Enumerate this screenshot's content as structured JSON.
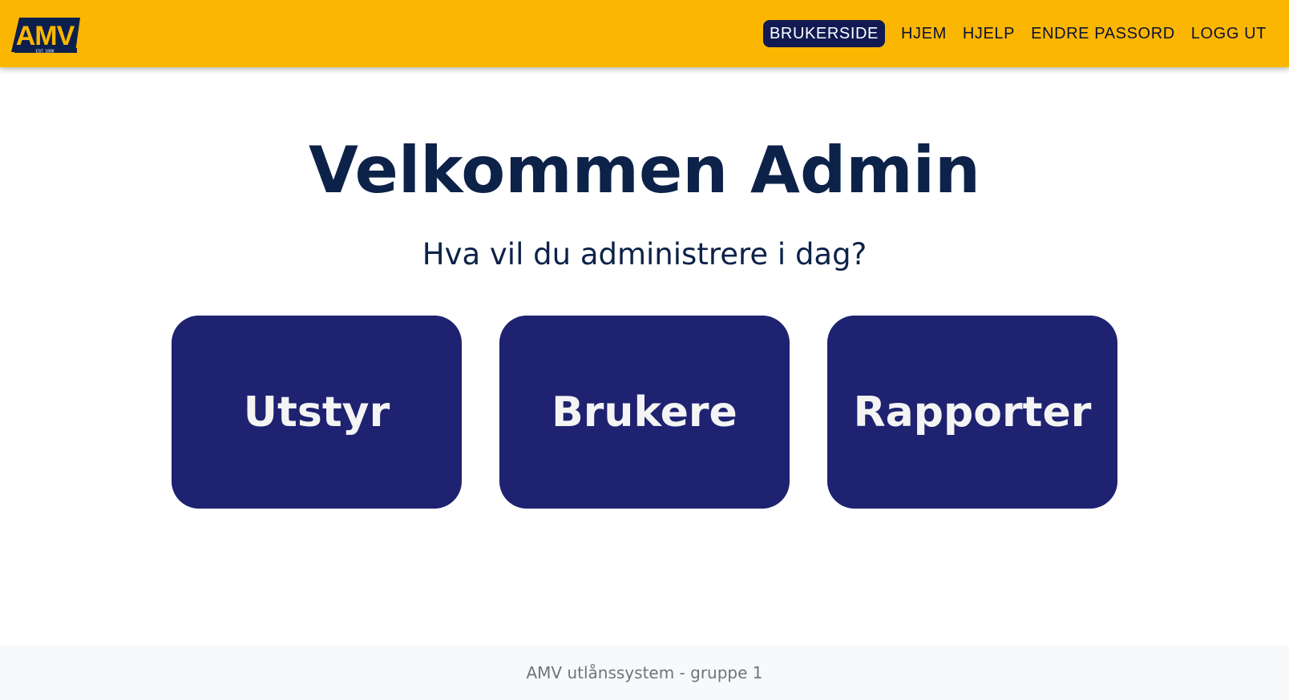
{
  "header": {
    "logo": {
      "text": "AMV",
      "tagline": "EST. 1888"
    },
    "nav": [
      {
        "label": "BRUKERSIDE",
        "active": true
      },
      {
        "label": "HJEM",
        "active": false
      },
      {
        "label": "HJELP",
        "active": false
      },
      {
        "label": "ENDRE PASSORD",
        "active": false
      },
      {
        "label": "LOGG UT",
        "active": false
      }
    ]
  },
  "main": {
    "title": "Velkommen Admin",
    "subtitle": "Hva vil du administrere i dag?",
    "cards": [
      {
        "label": "Utstyr"
      },
      {
        "label": "Brukere"
      },
      {
        "label": "Rapporter"
      }
    ]
  },
  "footer": {
    "text": "AMV utlånssystem - gruppe 1"
  },
  "colors": {
    "header_bg": "#fbb601",
    "accent": "#1e2270",
    "heading": "#0d2249",
    "footer_bg": "#f8f9fa"
  }
}
